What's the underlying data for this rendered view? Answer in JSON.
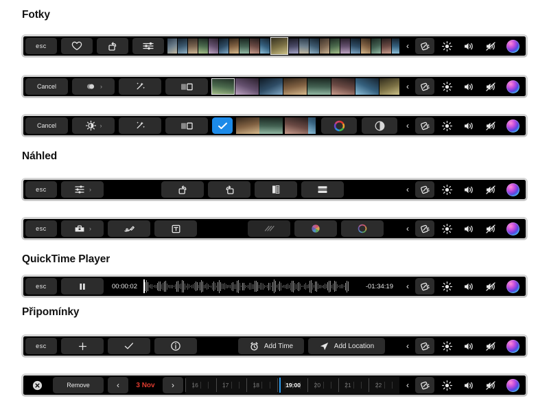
{
  "sections": [
    {
      "id": "fotky",
      "title": "Fotky"
    },
    {
      "id": "nahled",
      "title": "Náhled"
    },
    {
      "id": "quicktime",
      "title": "QuickTime Player"
    },
    {
      "id": "pripominky",
      "title": "Připomínky"
    }
  ],
  "common": {
    "esc_label": "esc",
    "cancel_label": "Cancel",
    "expand_chevron": "‹",
    "disclosure_chevron": "›",
    "system_icons": [
      "keyboard-brightness-icon",
      "display-brightness-icon",
      "volume-up-icon",
      "mute-icon",
      "siri-icon"
    ]
  },
  "bars": {
    "photos_browse": {
      "app": "Fotky",
      "keys": [
        {
          "name": "esc-key",
          "label": "esc",
          "icon": null
        },
        {
          "name": "favorite-key",
          "label": "",
          "icon": "heart-icon"
        },
        {
          "name": "rotate-key",
          "label": "",
          "icon": "rotate-left-icon"
        },
        {
          "name": "adjust-key",
          "label": "",
          "icon": "sliders-icon"
        }
      ],
      "filmstrip": {
        "name": "photo-filmstrip",
        "selected_index": 10,
        "count": 26
      }
    },
    "photos_filters": {
      "app": "Fotky",
      "keys": [
        {
          "name": "cancel-key",
          "label": "Cancel",
          "icon": null
        },
        {
          "name": "filters-key",
          "label": "",
          "icon": "filters-circles-icon",
          "chevron": "›"
        },
        {
          "name": "auto-enhance-key",
          "label": "",
          "icon": "magic-wand-icon"
        },
        {
          "name": "compare-key",
          "label": "",
          "icon": "compare-icon"
        }
      ],
      "filmstrip": {
        "name": "filter-preview-strip",
        "selected_index": 0,
        "count": 13
      }
    },
    "photos_adjust": {
      "app": "Fotky",
      "keys": [
        {
          "name": "cancel-key",
          "label": "Cancel",
          "icon": null
        },
        {
          "name": "light-adjust-key",
          "label": "",
          "icon": "sun-adjust-icon",
          "chevron": "›"
        },
        {
          "name": "auto-enhance-key",
          "label": "",
          "icon": "magic-wand-icon"
        },
        {
          "name": "compare-key",
          "label": "",
          "icon": "compare-icon"
        },
        {
          "name": "apply-key",
          "label": "",
          "icon": "checkmark-icon",
          "accent": "#1c8ae8"
        }
      ],
      "trailing_keys": [
        {
          "name": "color-key",
          "label": "",
          "icon": "color-wheel-icon"
        },
        {
          "name": "bw-key",
          "label": "",
          "icon": "contrast-icon"
        }
      ],
      "filmstrip": {
        "name": "adjust-preview-strip",
        "selected_index": 0,
        "count": 6
      }
    },
    "preview_view": {
      "app": "Náhled",
      "keys": [
        {
          "name": "esc-key",
          "label": "esc",
          "icon": null
        },
        {
          "name": "adjust-key",
          "label": "",
          "icon": "sliders-icon",
          "chevron": "›"
        }
      ],
      "center_keys": [
        {
          "name": "rotate-left-key",
          "label": "",
          "icon": "rotate-left-icon"
        },
        {
          "name": "rotate-right-key",
          "label": "",
          "icon": "rotate-right-icon"
        },
        {
          "name": "two-page-view-key",
          "label": "",
          "icon": "two-page-icon"
        },
        {
          "name": "continuous-scroll-key",
          "label": "",
          "icon": "continuous-scroll-icon"
        }
      ]
    },
    "preview_markup": {
      "app": "Náhled",
      "keys": [
        {
          "name": "esc-key",
          "label": "esc",
          "icon": null
        },
        {
          "name": "markup-key",
          "label": "",
          "icon": "toolbox-icon",
          "chevron": "›"
        },
        {
          "name": "sketch-key",
          "label": "",
          "icon": "sketch-pen-icon"
        },
        {
          "name": "text-box-key",
          "label": "",
          "icon": "text-box-icon"
        }
      ],
      "center_keys": [
        {
          "name": "line-style-key",
          "label": "",
          "icon": "line-style-icon"
        },
        {
          "name": "fill-color-key",
          "label": "",
          "icon": "color-wheel-filled-icon"
        },
        {
          "name": "stroke-color-key",
          "label": "",
          "icon": "color-wheel-outline-icon"
        }
      ]
    },
    "quicktime": {
      "app": "QuickTime Player",
      "keys": [
        {
          "name": "esc-key",
          "label": "esc",
          "icon": null
        },
        {
          "name": "pause-key",
          "label": "",
          "icon": "pause-icon"
        }
      ],
      "elapsed_time": "00:00:02",
      "remaining_time": "-01:34:19",
      "scrubber": {
        "name": "audio-waveform-scrubber",
        "playhead_percent": 1
      }
    },
    "reminders_new": {
      "app": "Připomínky",
      "keys": [
        {
          "name": "esc-key",
          "label": "esc",
          "icon": null
        },
        {
          "name": "add-key",
          "label": "",
          "icon": "plus-icon"
        },
        {
          "name": "complete-key",
          "label": "",
          "icon": "checkmark-icon"
        },
        {
          "name": "info-key",
          "label": "",
          "icon": "info-icon"
        }
      ],
      "center_keys": [
        {
          "name": "add-time-key",
          "label": "Add Time",
          "icon": "alarm-clock-icon"
        },
        {
          "name": "add-location-key",
          "label": "Add Location",
          "icon": "navigation-arrow-icon"
        }
      ]
    },
    "reminders_time": {
      "app": "Připomínky",
      "close_label": "",
      "remove_label": "Remove",
      "prev_label": "‹",
      "date_label": "3 Nov",
      "date_color": "#e03b2f",
      "next_label": "›",
      "ruler": {
        "name": "time-ruler",
        "hours": [
          "16",
          "17",
          "18",
          "20",
          "21",
          "22"
        ],
        "selected_time": "19:00",
        "selected_color": "#2a9bf0"
      }
    }
  }
}
